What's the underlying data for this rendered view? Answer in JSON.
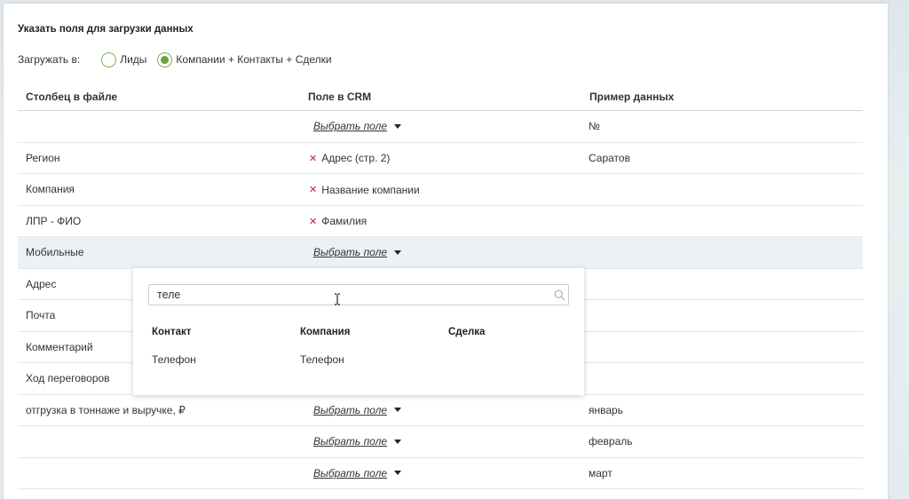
{
  "title": "Указать поля для загрузки данных",
  "load_into": {
    "label": "Загружать в:",
    "options": [
      {
        "label": "Лиды",
        "checked": false
      },
      {
        "label": "Компании + Контакты + Сделки",
        "checked": true
      }
    ]
  },
  "table": {
    "headers": [
      "Столбец в файле",
      "Поле в CRM",
      "Пример данных"
    ],
    "rows": [
      {
        "column": "",
        "field": "Выбрать поле",
        "mapped": false,
        "example": "№"
      },
      {
        "column": "Регион",
        "field": "Адрес (стр. 2)",
        "mapped": true,
        "example": "Саратов"
      },
      {
        "column": "Компания",
        "field": "Название компании",
        "mapped": true,
        "example": ""
      },
      {
        "column": "ЛПР - ФИО",
        "field": "Фамилия",
        "mapped": true,
        "example": ""
      },
      {
        "column": "Мобильные",
        "field": "Выбрать поле",
        "mapped": false,
        "example": ""
      },
      {
        "column": "Адрес",
        "field": "",
        "mapped": false,
        "example": ""
      },
      {
        "column": "Почта",
        "field": "",
        "mapped": false,
        "example": ""
      },
      {
        "column": "Комментарий",
        "field": "",
        "mapped": false,
        "example": ""
      },
      {
        "column": "Ход переговоров",
        "field": "",
        "mapped": false,
        "example": ""
      },
      {
        "column": "отгрузка в тоннаже и выручке, ₽",
        "field": "Выбрать поле",
        "mapped": false,
        "example": "январь"
      },
      {
        "column": "",
        "field": "Выбрать поле",
        "mapped": false,
        "example": "февраль"
      },
      {
        "column": "",
        "field": "Выбрать поле",
        "mapped": false,
        "example": "март"
      }
    ]
  },
  "dropdown": {
    "search_value": "теле",
    "columns": [
      {
        "header": "Контакт",
        "items": [
          "Телефон"
        ]
      },
      {
        "header": "Компания",
        "items": [
          "Телефон"
        ]
      },
      {
        "header": "Сделка",
        "items": []
      }
    ]
  },
  "colors": {
    "accent": "#6aa23c",
    "remove": "#c2185b"
  }
}
